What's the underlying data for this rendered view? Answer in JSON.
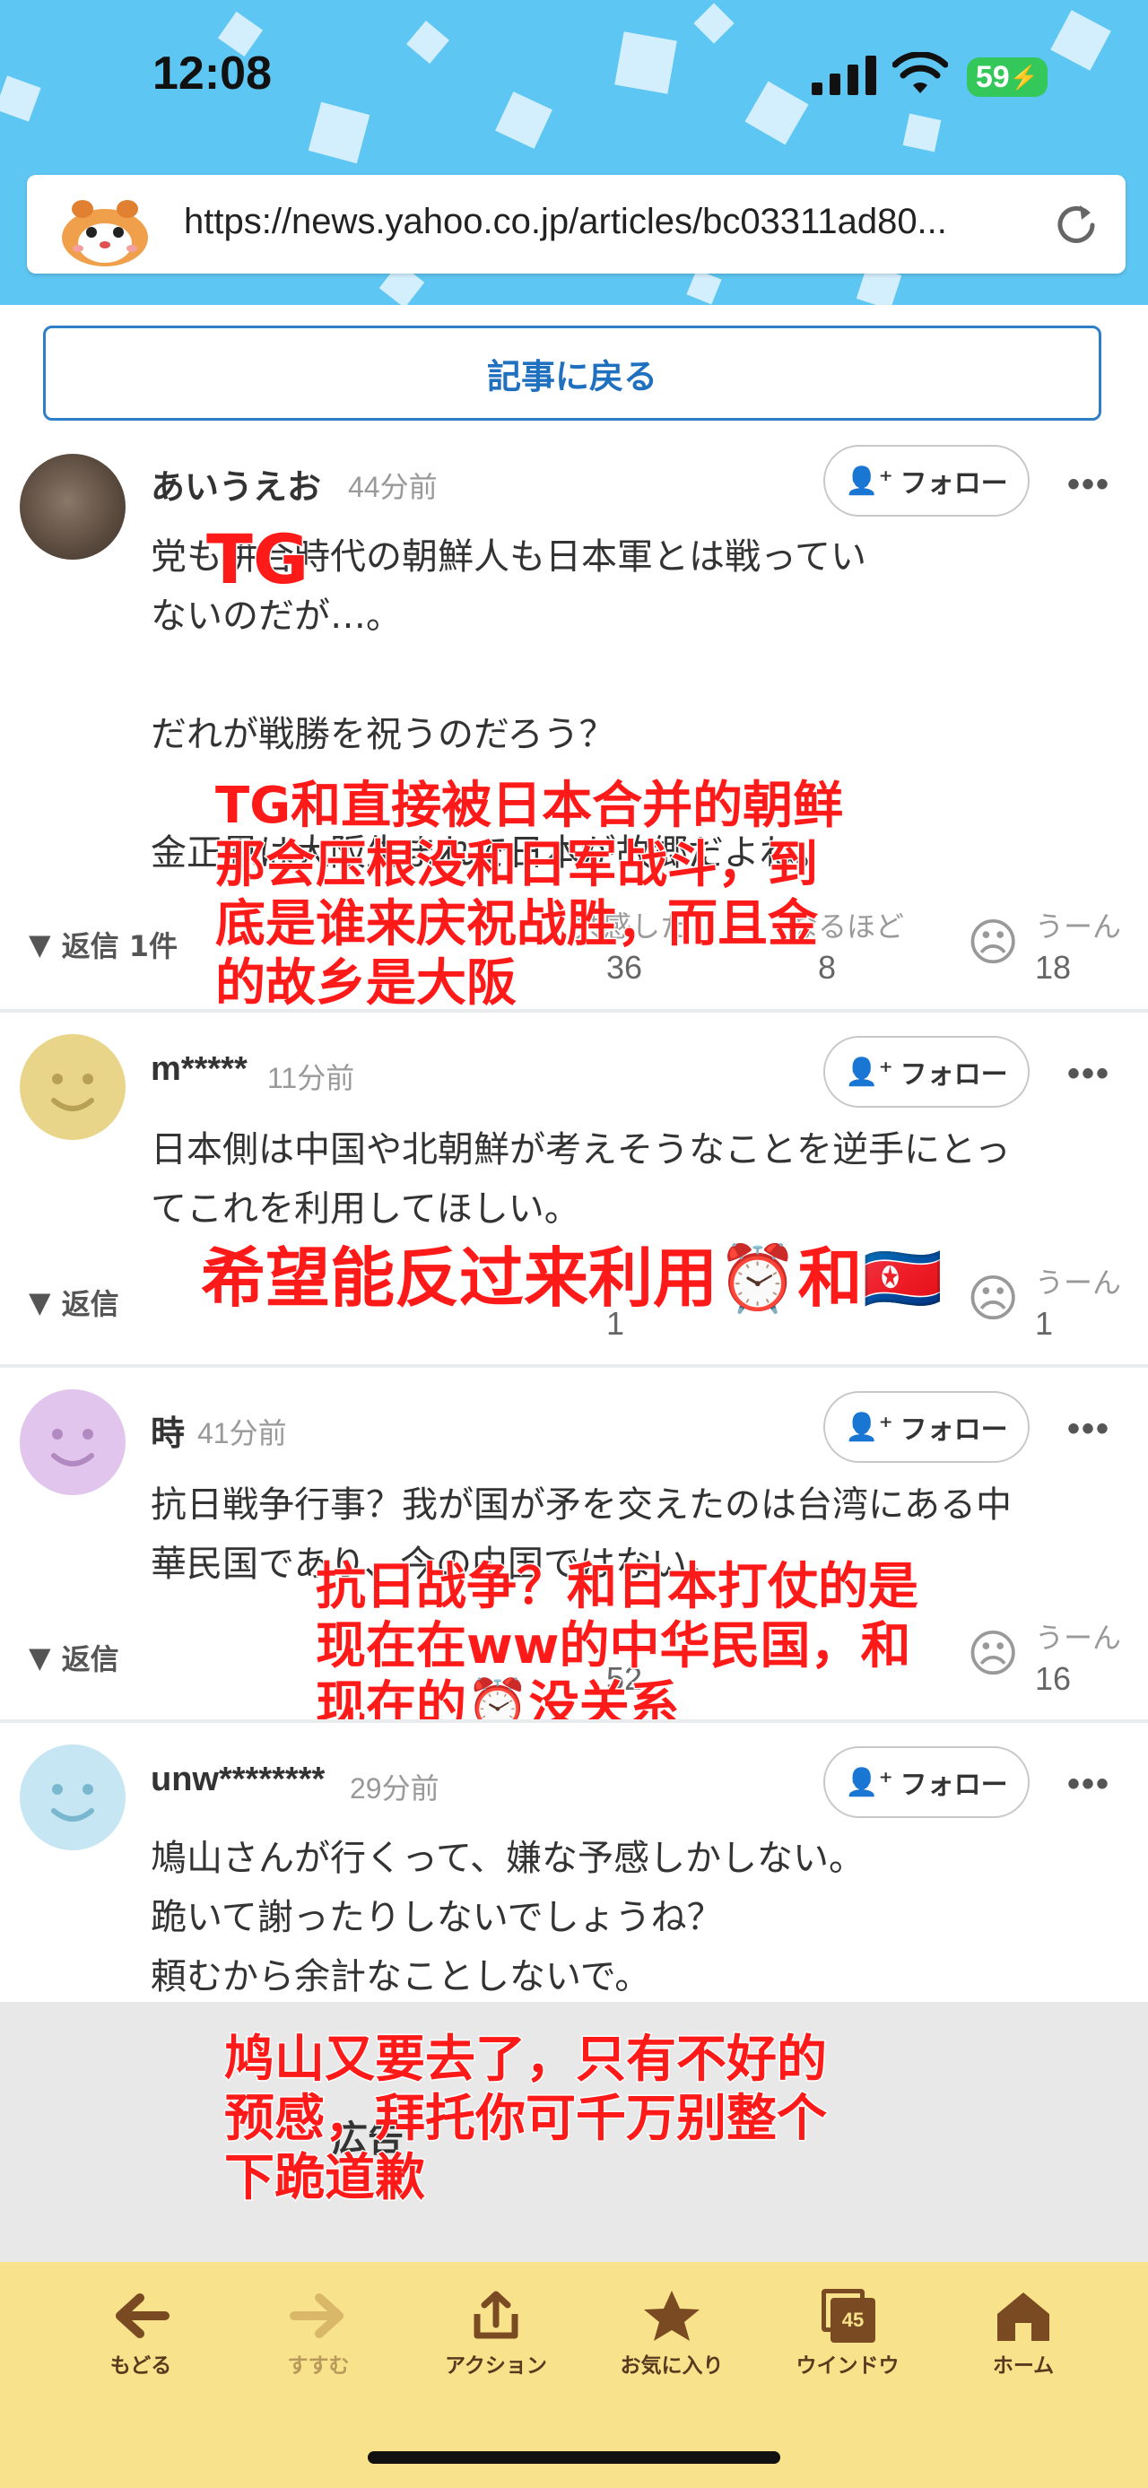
{
  "status": {
    "time": "12:08",
    "battery": "59"
  },
  "browser": {
    "url": "https://news.yahoo.co.jp/articles/bc03311ad80..."
  },
  "back_button": "記事に戻る",
  "follow_label": "フォロー",
  "comments": [
    {
      "user": "あいうえお",
      "time": "44分前",
      "lines": [
        "",
        "TG",
        "党も併合時代の朝鮮人も日本軍とは戦ってい",
        "ないのだが…。",
        "",
        "だれが戦勝を祝うのだろう？",
        "",
        "金正恩は大阪生まれで日本が故郷だよね。"
      ],
      "reply": "返信 1件",
      "reactions": [
        {
          "label": "共感した",
          "count": "36"
        },
        {
          "label": "なるほど",
          "count": "8"
        },
        {
          "label": "うーん",
          "count": "18"
        }
      ],
      "caption": "TG和直接被日本合并的朝鲜\n那会压根没和日军战斗，到\n底是谁来庆祝战胜，而且金\n的故乡是大阪"
    },
    {
      "user": "m*****",
      "time": "11分前",
      "lines": [
        "日本側は中国や北朝鮮が考えそうなことを逆手にとっ",
        "てこれを利用してほしい。"
      ],
      "reply": "返信",
      "reactions": [
        {
          "label": "共感した",
          "count": "1"
        },
        {
          "label": "なるほど",
          "count": ""
        },
        {
          "label": "うーん",
          "count": "1"
        }
      ],
      "caption": "希望能反过来利用⏰和🇰🇵"
    },
    {
      "user": "時",
      "time": "41分前",
      "lines": [
        "抗日戦争行事？我が国が矛を交えたのは台湾にある中",
        "華民国であり、今の中国ではない。"
      ],
      "reply": "返信",
      "reactions": [
        {
          "label": "共感した",
          "count": "52"
        },
        {
          "label": "なるほど",
          "count": ""
        },
        {
          "label": "うーん",
          "count": "16"
        }
      ],
      "caption": "抗日战争？和日本打仗的是\n现在在ww的中华民国，和\n现在的⏰没关系"
    },
    {
      "user": "unw********",
      "time": "29分前",
      "lines": [
        "鳩山さんが行くって、嫌な予感しかしない。",
        "跪いて謝ったりしないでしょうね？",
        "頼むから余計なことしないで。"
      ],
      "caption": "鸠山又要去了，只有不好的\n预感，拜托你可千万别整个\n下跪道歉"
    }
  ],
  "ad_label": "広告",
  "toolbar": [
    {
      "icon": "arrow-left-icon",
      "label": "もどる"
    },
    {
      "icon": "arrow-right-icon",
      "label": "すすむ"
    },
    {
      "icon": "share-icon",
      "label": "アクション"
    },
    {
      "icon": "star-icon",
      "label": "お気に入り"
    },
    {
      "icon": "windows-icon",
      "label": "ウインドウ",
      "badge": "45"
    },
    {
      "icon": "home-icon",
      "label": "ホーム"
    }
  ],
  "colors": {
    "sky": "#5ec6f2",
    "link_blue": "#2070c0",
    "caption_red": "#ff1a1a",
    "toolbar_yellow": "#f9e28c"
  }
}
